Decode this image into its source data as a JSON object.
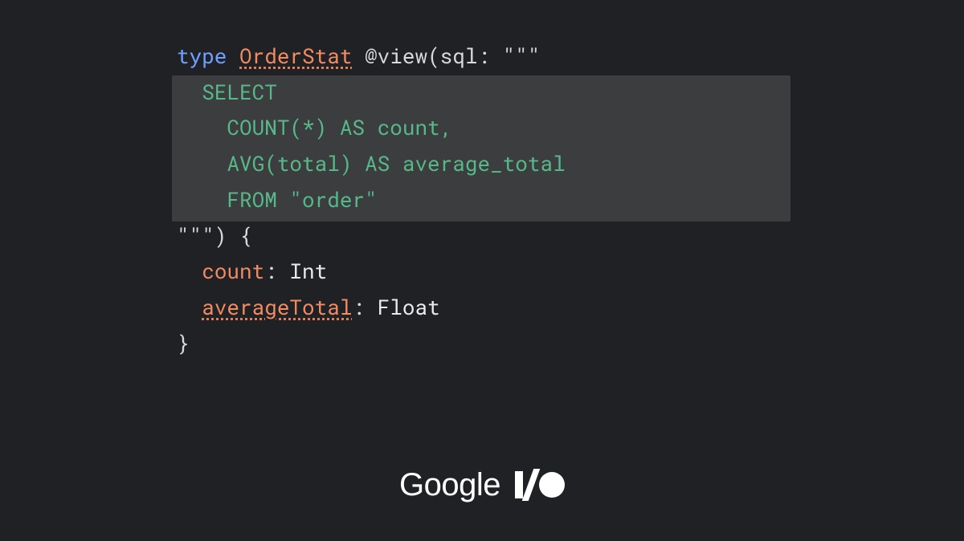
{
  "code": {
    "l1": {
      "keyword": "type",
      "typename": "OrderStat",
      "rest": " @view(sql: \"\"\""
    },
    "sql1": "  SELECT",
    "sql2": "    COUNT(*) AS count,",
    "sql3": "    AVG(total) AS average_total",
    "sql4": "    FROM \"order\"",
    "l6": "\"\"\") {",
    "field1": {
      "name": "count",
      "type": "Int"
    },
    "field2": {
      "name": "averageTotal",
      "type": "Float"
    },
    "l9": "}"
  },
  "logo": {
    "word": "Google"
  }
}
